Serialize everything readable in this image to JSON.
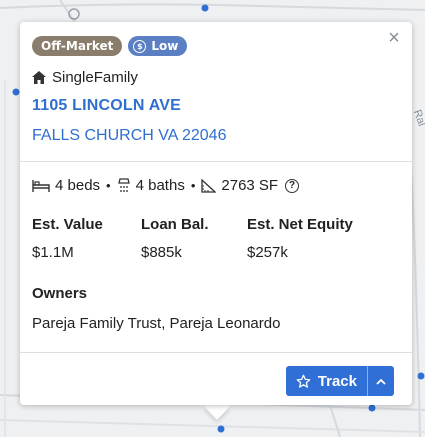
{
  "colors": {
    "accent": "#2f6fcf",
    "badge_off_market": "#8b7d6b",
    "badge_low": "#5a7fc2",
    "track_button": "#2f6fd6"
  },
  "popup": {
    "badges": {
      "status": "Off-Market",
      "equity_level": "Low",
      "equity_icon": "dollar-coin-icon"
    },
    "close_label": "×",
    "property_type": "SingleFamily",
    "property_type_icon": "home-icon",
    "address_line1": "1105 LINCOLN AVE",
    "address_line2": "FALLS CHURCH VA 22046",
    "specs": {
      "beds": "4 beds",
      "baths": "4 baths",
      "area": "2763 SF",
      "separator": "•",
      "info_symbol": "?"
    },
    "financials": {
      "est_value_label": "Est. Value",
      "est_value": "$1.1M",
      "loan_bal_label": "Loan Bal.",
      "loan_bal": "$885k",
      "net_equity_label": "Est. Net Equity",
      "net_equity": "$257k"
    },
    "owners_label": "Owners",
    "owners_value": "Pareja Family Trust, Pareja Leonardo",
    "track_label": "Track",
    "track_caret": "^"
  },
  "map": {
    "street_fragment": "Ral"
  }
}
